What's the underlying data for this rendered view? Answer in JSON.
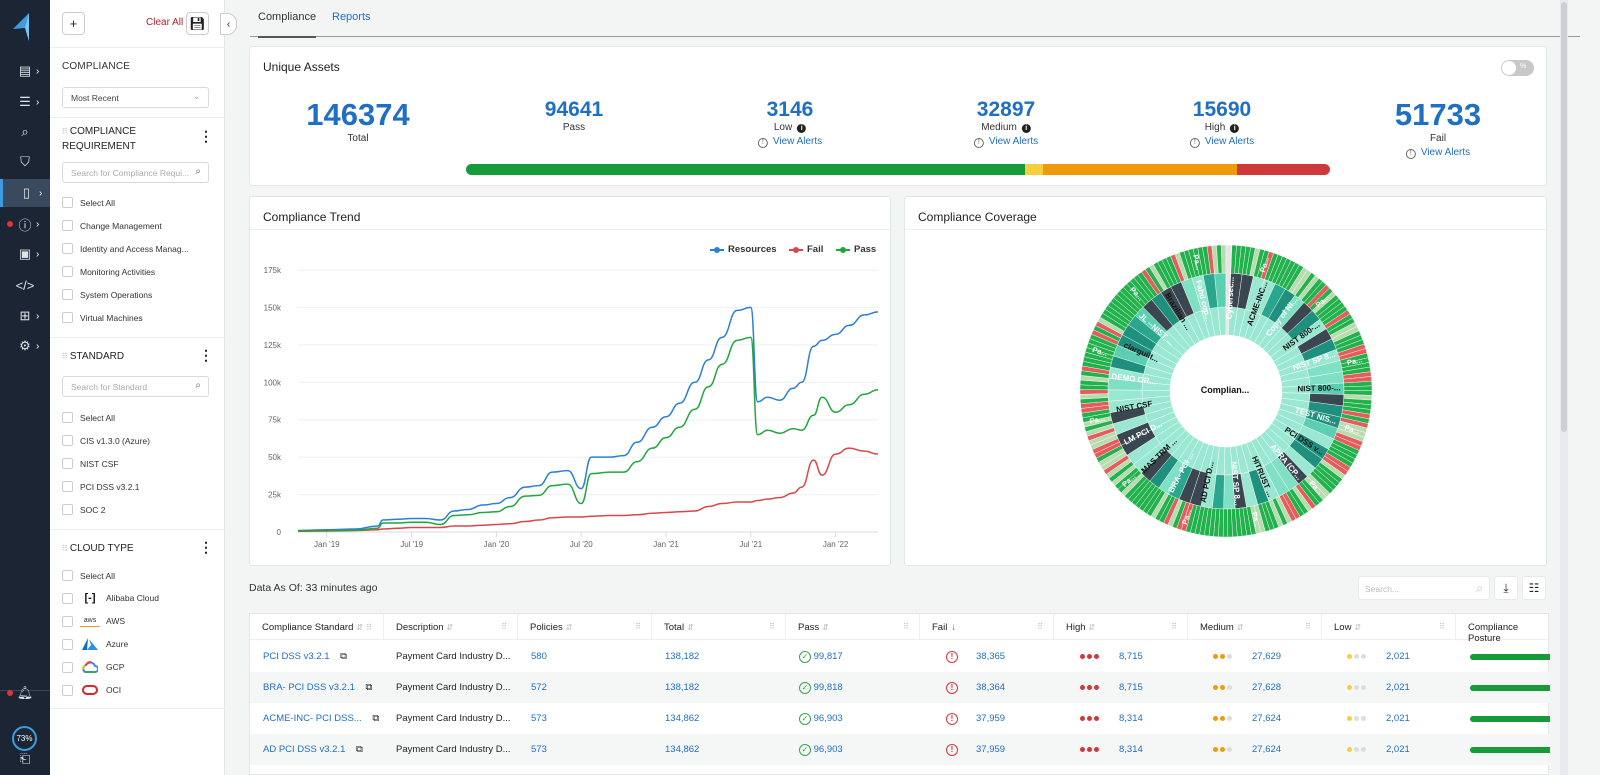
{
  "nav": {
    "items": [
      {
        "icon": "dashboard-icon",
        "has_chevron": true
      },
      {
        "icon": "list-icon",
        "has_chevron": true
      },
      {
        "icon": "investigate-icon",
        "has_chevron": false
      },
      {
        "icon": "shield-check-icon",
        "has_chevron": false
      },
      {
        "icon": "compliance-document-icon",
        "has_chevron": true,
        "active": true
      },
      {
        "icon": "alert-icon",
        "has_chevron": true,
        "badge": true
      },
      {
        "icon": "chip-icon",
        "has_chevron": true
      },
      {
        "icon": "code-icon",
        "has_chevron": false
      },
      {
        "icon": "network-icon",
        "has_chevron": true
      },
      {
        "icon": "settings-icon",
        "has_chevron": true
      }
    ],
    "progress_label": "73%"
  },
  "filter": {
    "add_label": "+",
    "clear_all": "Clear All",
    "compliance_title": "COMPLIANCE",
    "time_select": "Most Recent",
    "sections": {
      "requirement": {
        "title": "COMPLIANCE REQUIREMENT",
        "search_placeholder": "Search for Compliance Requi...",
        "options": [
          "Select All",
          "Change Management",
          "Identity and Access Manag...",
          "Monitoring Activities",
          "System Operations",
          "Virtual Machines"
        ]
      },
      "standard": {
        "title": "STANDARD",
        "search_placeholder": "Search for Standard",
        "options": [
          "Select All",
          "CIS v1.3.0 (Azure)",
          "NIST CSF",
          "PCI DSS v3.2.1",
          "SOC 2"
        ]
      },
      "cloud": {
        "title": "CLOUD TYPE",
        "options": [
          "Select All",
          "Alibaba Cloud",
          "AWS",
          "Azure",
          "GCP",
          "OCI"
        ]
      }
    }
  },
  "tabs": [
    {
      "label": "Compliance",
      "active": true
    },
    {
      "label": "Reports",
      "active": false
    }
  ],
  "unique_assets": {
    "title": "Unique Assets",
    "toggle_label": "%",
    "total": {
      "value": "146374",
      "label": "Total"
    },
    "pass": {
      "value": "94641",
      "label": "Pass"
    },
    "low": {
      "value": "3146",
      "label": "Low",
      "link": "View Alerts"
    },
    "medium": {
      "value": "32897",
      "label": "Medium",
      "link": "View Alerts"
    },
    "high": {
      "value": "15690",
      "label": "High",
      "link": "View Alerts"
    },
    "fail": {
      "value": "51733",
      "label": "Fail",
      "link": "View Alerts"
    },
    "severity_bar": [
      {
        "name": "pass",
        "value": 94641,
        "color": "#169a3a"
      },
      {
        "name": "low",
        "value": 3146,
        "color": "#f7cf3c"
      },
      {
        "name": "medium",
        "value": 32897,
        "color": "#ef9a0b"
      },
      {
        "name": "high",
        "value": 15690,
        "color": "#d0393c"
      }
    ]
  },
  "trend": {
    "title": "Compliance Trend",
    "chart_data": {
      "type": "line",
      "title": "Compliance Trend",
      "xlabel": "",
      "ylabel": "",
      "ylim": [
        0,
        175000
      ],
      "yticks": [
        0,
        25000,
        50000,
        75000,
        100000,
        125000,
        150000,
        175000
      ],
      "ytick_labels": [
        "0",
        "25k",
        "50k",
        "75k",
        "100k",
        "125k",
        "150k",
        "175k"
      ],
      "xlim": [
        2018.83,
        2022.25
      ],
      "xticks": [
        2019.0,
        2019.5,
        2020.0,
        2020.5,
        2021.0,
        2021.5,
        2022.0
      ],
      "xtick_labels": [
        "Jan '19",
        "Jul '19",
        "Jan '20",
        "Jul '20",
        "Jan '21",
        "Jul '21",
        "Jan '22"
      ],
      "legend": "top-right",
      "grid": true,
      "x": [
        2018.83,
        2019.0,
        2019.17,
        2019.3,
        2019.33,
        2019.42,
        2019.5,
        2019.58,
        2019.67,
        2019.75,
        2019.83,
        2019.92,
        2020.0,
        2020.08,
        2020.17,
        2020.25,
        2020.33,
        2020.42,
        2020.5,
        2020.56,
        2020.67,
        2020.75,
        2020.83,
        2020.92,
        2021.0,
        2021.08,
        2021.17,
        2021.25,
        2021.33,
        2021.42,
        2021.5,
        2021.54,
        2021.6,
        2021.67,
        2021.75,
        2021.8,
        2021.87,
        2021.92,
        2022.0,
        2022.08,
        2022.17,
        2022.25
      ],
      "series": [
        {
          "name": "Resources",
          "color": "#2b7fd4",
          "values": [
            1000,
            1500,
            2000,
            4000,
            8000,
            8500,
            9000,
            9000,
            8000,
            14000,
            15000,
            18000,
            19000,
            23000,
            30000,
            31000,
            40000,
            41000,
            29000,
            50000,
            50000,
            51000,
            60000,
            70000,
            77000,
            86000,
            100000,
            115000,
            130000,
            148000,
            150000,
            87000,
            90000,
            88000,
            96000,
            100000,
            124000,
            128000,
            132000,
            138000,
            145000,
            147000
          ]
        },
        {
          "name": "Fail",
          "color": "#d9474a",
          "values": [
            500,
            700,
            1000,
            1500,
            2000,
            2500,
            3000,
            3000,
            3000,
            4000,
            4000,
            4500,
            5000,
            5500,
            7000,
            8000,
            9500,
            10000,
            10000,
            10500,
            11000,
            11000,
            11500,
            12500,
            13000,
            13500,
            14000,
            17000,
            19000,
            20000,
            20000,
            21000,
            22000,
            23000,
            26000,
            30000,
            48000,
            38000,
            52000,
            56000,
            54000,
            52000
          ]
        },
        {
          "name": "Pass",
          "color": "#21a63f",
          "values": [
            800,
            1000,
            1200,
            2500,
            6000,
            6000,
            6500,
            6500,
            5000,
            11000,
            11500,
            13000,
            13500,
            17000,
            24000,
            24500,
            31000,
            32000,
            19000,
            39000,
            40000,
            40000,
            47000,
            56000,
            63000,
            70000,
            82000,
            97000,
            112000,
            128000,
            130000,
            65000,
            68000,
            66000,
            69000,
            68000,
            78000,
            90000,
            80000,
            85000,
            92000,
            95000
          ]
        }
      ]
    }
  },
  "coverage": {
    "title": "Compliance Coverage",
    "center_label": "Complian...",
    "segment_labels": [
      "Cybersec...",
      "ACME-INC...",
      "Copy of NI...",
      "NIST 800-...",
      "NIST SP 8...",
      "NIST 800-...",
      "TEST NIS...",
      "PCI DSS v...",
      "APRA (CP...",
      "HITRUST ...",
      "NIST SP 8...",
      "AD PCI D...",
      "BRA- PCI ...",
      "MAS TRM ...",
      "LM PCI D...",
      "NIST CSF",
      "DEMO OR...",
      "clarguilt...",
      "JL --NIST ...",
      "Brazilian ...",
      "Fahd cop..."
    ],
    "outer_label": "Pa..."
  },
  "table_area": {
    "data_as_of": "Data As Of: 33 minutes ago",
    "search_placeholder": "Search...",
    "columns": [
      "Compliance Standard",
      "Description",
      "Policies",
      "Total",
      "Pass",
      "Fail",
      "High",
      "Medium",
      "Low",
      "Compliance Posture"
    ],
    "sorted_column": "Fail",
    "rows": [
      {
        "standard": "PCI DSS v3.2.1",
        "description": "Payment Card Industry D...",
        "policies": "580",
        "total": "138,182",
        "pass": "99,817",
        "fail": "38,365",
        "high": "8,715",
        "medium": "27,629",
        "low": "2,021"
      },
      {
        "standard": "BRA- PCI DSS v3.2.1",
        "description": "Payment Card Industry D...",
        "policies": "572",
        "total": "138,182",
        "pass": "99,818",
        "fail": "38,364",
        "high": "8,715",
        "medium": "27,628",
        "low": "2,021"
      },
      {
        "standard": "ACME-INC- PCI DSS...",
        "description": "Payment Card Industry D...",
        "policies": "573",
        "total": "134,862",
        "pass": "96,903",
        "fail": "37,959",
        "high": "8,314",
        "medium": "27,624",
        "low": "2,021"
      },
      {
        "standard": "AD PCI DSS v3.2.1",
        "description": "Payment Card Industry D...",
        "policies": "573",
        "total": "134,862",
        "pass": "96,903",
        "fail": "37,959",
        "high": "8,314",
        "medium": "27,624",
        "low": "2,021"
      }
    ]
  }
}
